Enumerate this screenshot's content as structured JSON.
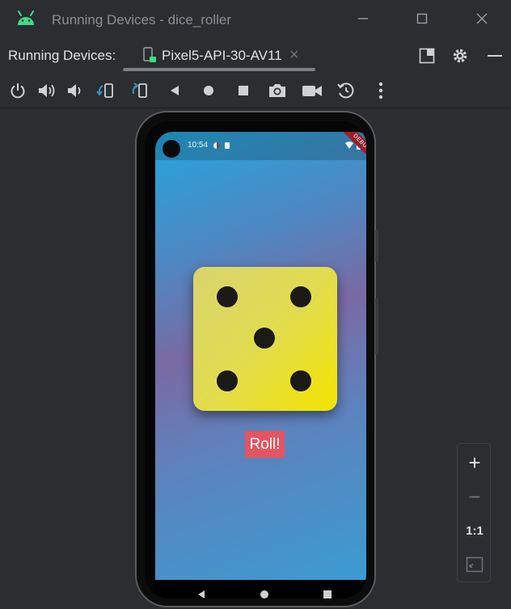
{
  "window": {
    "title": "Running Devices - dice_roller",
    "app_icon": "android-icon",
    "controls": [
      "minimize-icon",
      "maximize-icon",
      "close-icon"
    ]
  },
  "tabstrip": {
    "label": "Running Devices:",
    "tab": {
      "label": "Pixel5-API-30-AV11",
      "close": "×",
      "icon": "phone-icon"
    },
    "actions": [
      "layout-icon",
      "gear-icon",
      "hide-icon"
    ]
  },
  "toolbar": {
    "items": [
      "power-icon",
      "volume-up-icon",
      "volume-down-icon",
      "rotate-left-icon",
      "rotate-right-icon",
      "back-icon",
      "home-icon",
      "overview-icon",
      "screenshot-icon",
      "screen-record-icon",
      "snapshot-icon",
      "more-icon"
    ]
  },
  "device": {
    "status_time": "10:54",
    "debug_banner": "DEBUG",
    "dice_value": 5,
    "roll_label": "Roll!",
    "nav": [
      "back-icon",
      "home-icon",
      "recents-icon"
    ]
  },
  "zoom": {
    "zoom_in": "+",
    "zoom_out": "−",
    "actual_size": "1:1",
    "fit": "fit-screen-icon"
  },
  "colors": {
    "accent_green": "#3ddc84",
    "roll_button": "#e55560",
    "dice_face": "#e8e04a",
    "gradient_top": "#24a6dc",
    "gradient_mid": "#7a6aa3"
  }
}
